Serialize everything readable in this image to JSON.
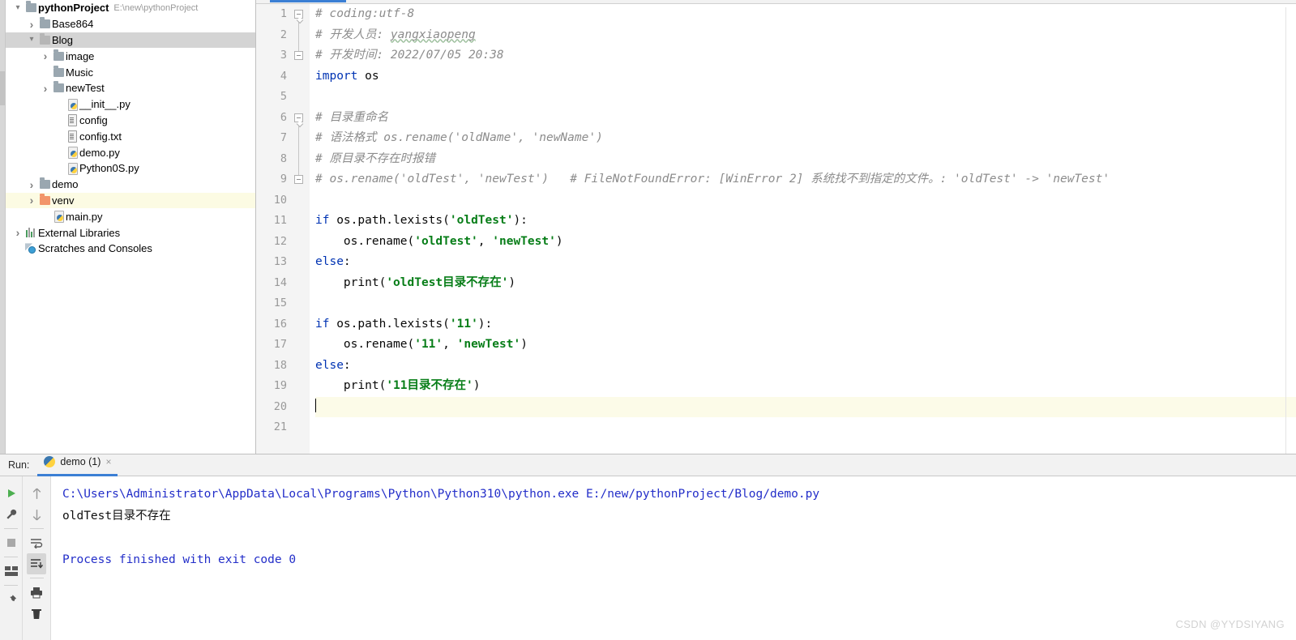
{
  "project_tree": {
    "items": [
      {
        "label": "pythonProject",
        "sub": "E:\\new\\pythonProject",
        "icon": "folder-icon",
        "arrow": "down",
        "indent": 0,
        "bold": true,
        "state": "normal"
      },
      {
        "label": "Base864",
        "sub": "",
        "icon": "folder-icon",
        "arrow": "right",
        "indent": 1,
        "bold": false,
        "state": "normal"
      },
      {
        "label": "Blog",
        "sub": "",
        "icon": "folder-icon",
        "arrow": "down",
        "indent": 1,
        "bold": false,
        "state": "selected"
      },
      {
        "label": "image",
        "sub": "",
        "icon": "folder-icon",
        "arrow": "right",
        "indent": 2,
        "bold": false,
        "state": "normal"
      },
      {
        "label": "Music",
        "sub": "",
        "icon": "folder-icon",
        "arrow": "none",
        "indent": 2,
        "bold": false,
        "state": "normal"
      },
      {
        "label": "newTest",
        "sub": "",
        "icon": "folder-icon",
        "arrow": "right",
        "indent": 2,
        "bold": false,
        "state": "normal"
      },
      {
        "label": "__init__.py",
        "sub": "",
        "icon": "python-file-icon",
        "arrow": "none",
        "indent": 3,
        "bold": false,
        "state": "normal"
      },
      {
        "label": "config",
        "sub": "",
        "icon": "text-file-icon",
        "arrow": "none",
        "indent": 3,
        "bold": false,
        "state": "normal"
      },
      {
        "label": "config.txt",
        "sub": "",
        "icon": "text-file-icon",
        "arrow": "none",
        "indent": 3,
        "bold": false,
        "state": "normal"
      },
      {
        "label": "demo.py",
        "sub": "",
        "icon": "python-file-icon",
        "arrow": "none",
        "indent": 3,
        "bold": false,
        "state": "normal"
      },
      {
        "label": "Python0S.py",
        "sub": "",
        "icon": "python-file-icon",
        "arrow": "none",
        "indent": 3,
        "bold": false,
        "state": "normal"
      },
      {
        "label": "demo",
        "sub": "",
        "icon": "folder-icon",
        "arrow": "right",
        "indent": 1,
        "bold": false,
        "state": "normal"
      },
      {
        "label": "venv",
        "sub": "",
        "icon": "folder-orange-icon",
        "arrow": "right",
        "indent": 1,
        "bold": false,
        "state": "marked"
      },
      {
        "label": "main.py",
        "sub": "",
        "icon": "python-file-icon",
        "arrow": "none",
        "indent": 2,
        "bold": false,
        "state": "normal"
      },
      {
        "label": "External Libraries",
        "sub": "",
        "icon": "library-icon",
        "arrow": "right",
        "indent": 0,
        "bold": false,
        "state": "normal"
      },
      {
        "label": "Scratches and Consoles",
        "sub": "",
        "icon": "scratches-icon",
        "arrow": "none",
        "indent": 0,
        "bold": false,
        "state": "normal"
      }
    ]
  },
  "editor": {
    "caret_line": 20,
    "lines": [
      {
        "n": 1,
        "tokens": [
          {
            "t": "# coding:utf-8",
            "c": "cm"
          }
        ],
        "fold": "start"
      },
      {
        "n": 2,
        "tokens": [
          {
            "t": "# 开发人员: ",
            "c": "cm"
          },
          {
            "t": "yangxiaopeng",
            "c": "cm spell"
          }
        ]
      },
      {
        "n": 3,
        "tokens": [
          {
            "t": "# 开发时间: 2022/07/05 20:38",
            "c": "cm"
          }
        ],
        "fold": "end"
      },
      {
        "n": 4,
        "tokens": [
          {
            "t": "import",
            "c": "kw"
          },
          {
            "t": " os",
            "c": "pl"
          }
        ]
      },
      {
        "n": 5,
        "tokens": []
      },
      {
        "n": 6,
        "tokens": [
          {
            "t": "# 目录重命名",
            "c": "cm"
          }
        ],
        "fold": "start"
      },
      {
        "n": 7,
        "tokens": [
          {
            "t": "# 语法格式 os.rename('oldName', 'newName')",
            "c": "cm"
          }
        ]
      },
      {
        "n": 8,
        "tokens": [
          {
            "t": "# 原目录不存在时报错",
            "c": "cm"
          }
        ]
      },
      {
        "n": 9,
        "tokens": [
          {
            "t": "# os.rename('oldTest', 'newTest')   # FileNotFoundError: [WinError 2] 系统找不到指定的文件。: 'oldTest' -> 'newTest'",
            "c": "cm"
          }
        ],
        "fold": "end"
      },
      {
        "n": 10,
        "tokens": []
      },
      {
        "n": 11,
        "tokens": [
          {
            "t": "if",
            "c": "kw"
          },
          {
            "t": " os.path.lexists(",
            "c": "pl"
          },
          {
            "t": "'oldTest'",
            "c": "st"
          },
          {
            "t": "):",
            "c": "pl"
          }
        ]
      },
      {
        "n": 12,
        "tokens": [
          {
            "t": "    os.rename(",
            "c": "pl"
          },
          {
            "t": "'oldTest'",
            "c": "st"
          },
          {
            "t": ", ",
            "c": "pl"
          },
          {
            "t": "'newTest'",
            "c": "st"
          },
          {
            "t": ")",
            "c": "pl"
          }
        ]
      },
      {
        "n": 13,
        "tokens": [
          {
            "t": "else",
            "c": "kw"
          },
          {
            "t": ":",
            "c": "pl"
          }
        ]
      },
      {
        "n": 14,
        "tokens": [
          {
            "t": "    print(",
            "c": "pl"
          },
          {
            "t": "'oldTest目录不存在'",
            "c": "st"
          },
          {
            "t": ")",
            "c": "pl"
          }
        ]
      },
      {
        "n": 15,
        "tokens": []
      },
      {
        "n": 16,
        "tokens": [
          {
            "t": "if",
            "c": "kw"
          },
          {
            "t": " os.path.lexists(",
            "c": "pl"
          },
          {
            "t": "'11'",
            "c": "st"
          },
          {
            "t": "):",
            "c": "pl"
          }
        ]
      },
      {
        "n": 17,
        "tokens": [
          {
            "t": "    os.rename(",
            "c": "pl"
          },
          {
            "t": "'11'",
            "c": "st"
          },
          {
            "t": ", ",
            "c": "pl"
          },
          {
            "t": "'newTest'",
            "c": "st"
          },
          {
            "t": ")",
            "c": "pl"
          }
        ]
      },
      {
        "n": 18,
        "tokens": [
          {
            "t": "else",
            "c": "kw"
          },
          {
            "t": ":",
            "c": "pl"
          }
        ]
      },
      {
        "n": 19,
        "tokens": [
          {
            "t": "    print(",
            "c": "pl"
          },
          {
            "t": "'11目录不存在'",
            "c": "st"
          },
          {
            "t": ")",
            "c": "pl"
          }
        ]
      },
      {
        "n": 20,
        "tokens": [],
        "caret": true
      },
      {
        "n": 21,
        "tokens": []
      }
    ]
  },
  "run_panel": {
    "label": "Run:",
    "tab_name": "demo (1)",
    "close_label": "×",
    "toolbar_left": [
      "run-icon",
      "settings-wrench-icon",
      "stop-icon",
      "layout-icon",
      "pin-icon"
    ],
    "toolbar_right": [
      "scroll-up-icon",
      "scroll-down-icon",
      "soft-wrap-icon",
      "scroll-to-end-icon",
      "print-icon",
      "clear-all-icon"
    ],
    "console_lines": [
      {
        "text": "C:\\Users\\Administrator\\AppData\\Local\\Programs\\Python\\Python310\\python.exe E:/new/pythonProject/Blog/demo.py",
        "color": "blue"
      },
      {
        "text": "oldTest目录不存在",
        "color": "black"
      },
      {
        "text": "",
        "color": "black"
      },
      {
        "text": "Process finished with exit code 0",
        "color": "blue"
      }
    ]
  },
  "watermark": "CSDN @YYDSIYANG",
  "colors": {
    "accent_blue": "#3b7fd4",
    "keyword": "#0033b3",
    "string": "#067d17",
    "comment": "#8c8c8c",
    "console_blue": "#232ec9",
    "caret_line": "#fcfbe8",
    "selection": "#d4d4d4"
  }
}
